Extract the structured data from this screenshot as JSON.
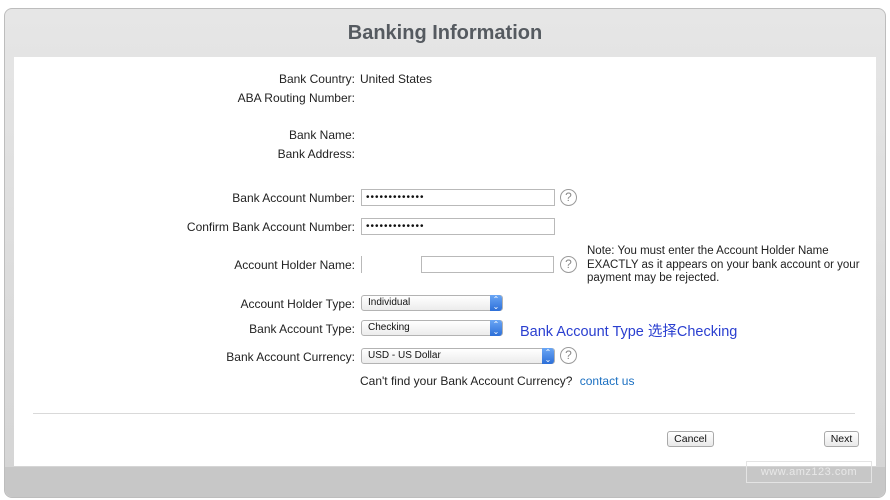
{
  "window": {
    "title": "Banking Information"
  },
  "fields": {
    "bank_country_label": "Bank Country:",
    "bank_country_value": "United States",
    "aba_routing_label": "ABA Routing Number:",
    "bank_name_label": "Bank Name:",
    "bank_address_label": "Bank Address:",
    "account_number_label": "Bank Account Number:",
    "account_number_value": "•••••••••••••",
    "confirm_account_label": "Confirm Bank Account Number:",
    "confirm_account_value": "•••••••••••••",
    "holder_name_label": "Account Holder Name:",
    "holder_name_value": "",
    "holder_type_label": "Account Holder Type:",
    "holder_type_value": "Individual",
    "account_type_label": "Bank Account Type:",
    "account_type_value": "Checking",
    "currency_label": "Bank Account Currency:",
    "currency_value": "USD - US Dollar"
  },
  "note": "Note: You must enter the Account Holder Name EXACTLY as it appears on your bank account or your payment may be rejected.",
  "annotation": "Bank Account Type 选择Checking",
  "currency_help": {
    "question": "Can't find your Bank Account Currency?",
    "link": "contact us"
  },
  "buttons": {
    "cancel": "Cancel",
    "next": "Next"
  },
  "icons": {
    "help": "question-mark-icon",
    "select_arrows": "up-down-chevron-icon"
  },
  "watermark": "www.amz123.com",
  "colors": {
    "annotation": "#2a3fd0",
    "link": "#1a6fc1",
    "select_accent": "#2d6fd8"
  }
}
